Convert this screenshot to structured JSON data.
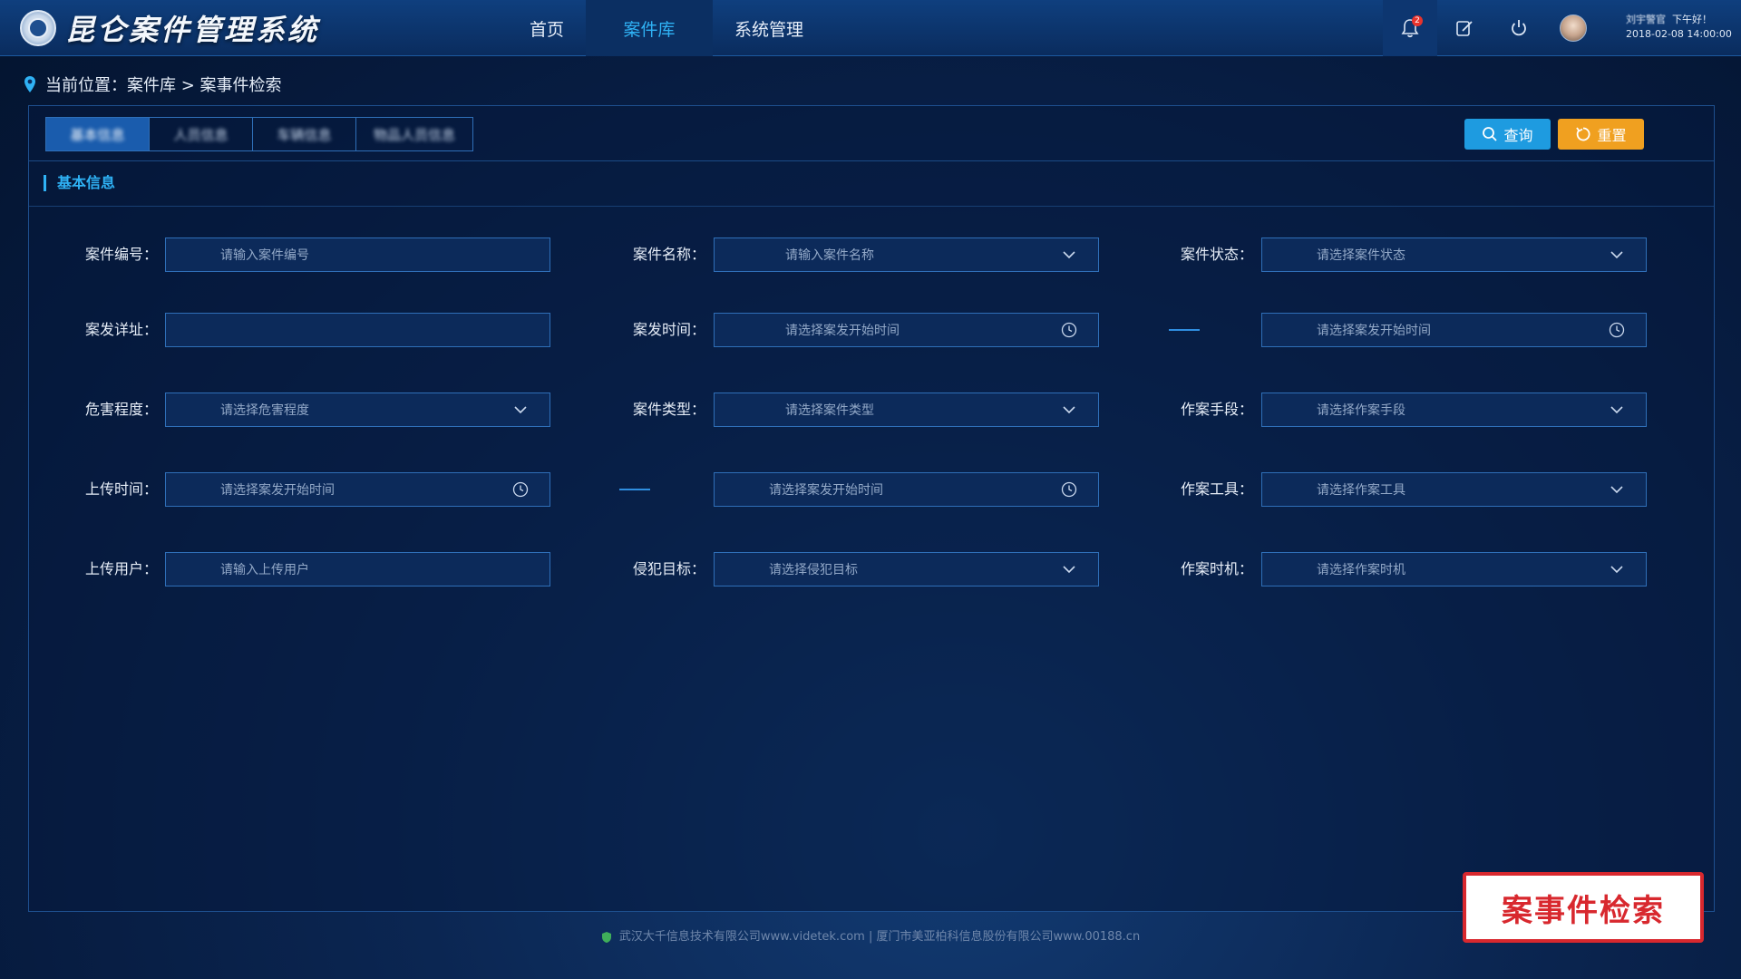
{
  "header": {
    "app_title": "昆仑案件管理系统",
    "nav": [
      {
        "label": "首页",
        "active": false
      },
      {
        "label": "案件库",
        "active": true
      },
      {
        "label": "系统管理",
        "active": false
      }
    ],
    "notification_count": "2",
    "user_name": "刘宇警官",
    "greeting": "下午好！",
    "datetime": "2018-02-08 14:00:00"
  },
  "breadcrumb": {
    "text": "当前位置：案件库 > 案事件检索"
  },
  "tabs": [
    {
      "label": "基本信息",
      "active": true
    },
    {
      "label": "人员信息",
      "active": false
    },
    {
      "label": "车辆信息",
      "active": false
    },
    {
      "label": "物品人员信息",
      "active": false
    }
  ],
  "buttons": {
    "query": "查询",
    "reset": "重置"
  },
  "section_title": "基本信息",
  "form": {
    "case_no": {
      "label": "案件编号：",
      "placeholder": "请输入案件编号"
    },
    "case_name": {
      "label": "案件名称：",
      "placeholder": "请输入案件名称"
    },
    "case_status": {
      "label": "案件状态：",
      "placeholder": "请选择案件状态"
    },
    "case_address": {
      "label": "案发详址：",
      "placeholder": ""
    },
    "case_time": {
      "label": "案发时间：",
      "placeholder_start": "请选择案发开始时间",
      "placeholder_end": "请选择案发开始时间"
    },
    "harm_level": {
      "label": "危害程度：",
      "placeholder": "请选择危害程度"
    },
    "case_type": {
      "label": "案件类型：",
      "placeholder": "请选择案件类型"
    },
    "method": {
      "label": "作案手段：",
      "placeholder": "请选择作案手段"
    },
    "upload_time": {
      "label": "上传时间：",
      "placeholder_start": "请选择案发开始时间",
      "placeholder_end": "请选择案发开始时间"
    },
    "tool": {
      "label": "作案工具：",
      "placeholder": "请选择作案工具"
    },
    "upload_user": {
      "label": "上传用户：",
      "placeholder": "请输入上传用户"
    },
    "target": {
      "label": "侵犯目标：",
      "placeholder": "请选择侵犯目标"
    },
    "timing": {
      "label": "作案时机：",
      "placeholder": "请选择作案时机"
    }
  },
  "footer": {
    "text": "武汉大千信息技术有限公司www.videtek.com | 厦门市美亚柏科信息股份有限公司www.00188.cn"
  },
  "caption": "案事件检索",
  "colors": {
    "accent": "#2fb2f5",
    "query_button": "#1e9be0",
    "reset_button": "#f0a020",
    "caption_red": "#d8282e"
  }
}
